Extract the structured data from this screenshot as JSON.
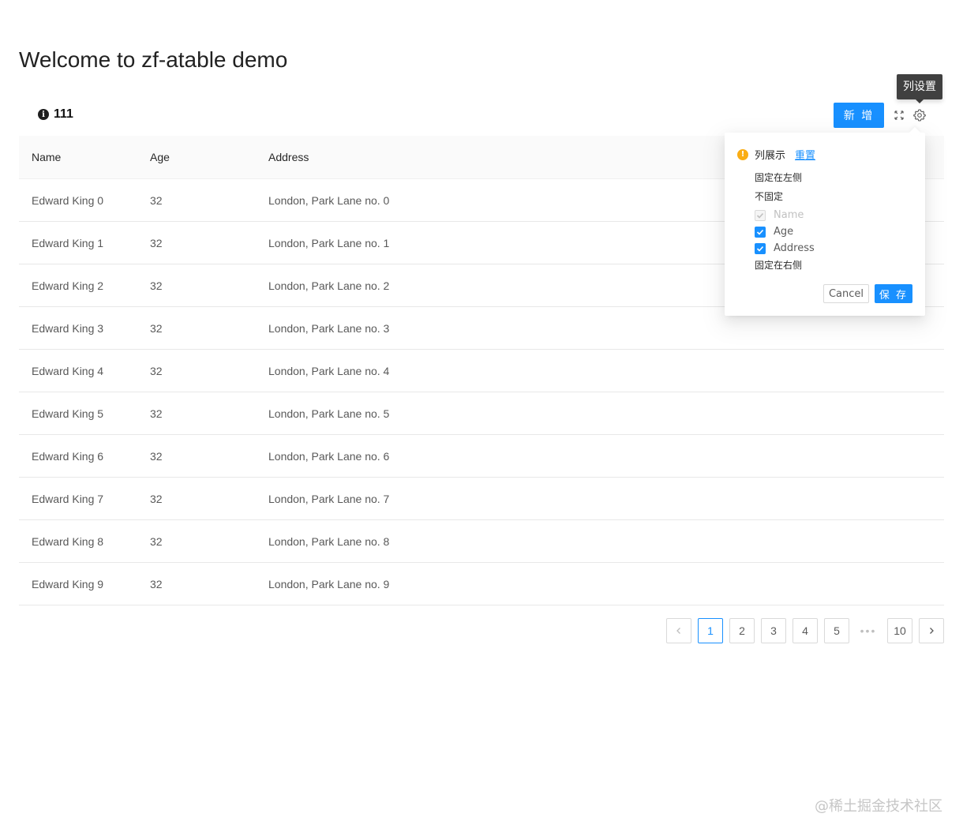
{
  "page": {
    "title": "Welcome to zf-atable demo"
  },
  "toolbar": {
    "info_value": "111",
    "add_button": "新 增",
    "tooltip": "列设置"
  },
  "table": {
    "headers": [
      "Name",
      "Age",
      "Address"
    ],
    "rows": [
      [
        "Edward King 0",
        "32",
        "London, Park Lane no. 0"
      ],
      [
        "Edward King 1",
        "32",
        "London, Park Lane no. 1"
      ],
      [
        "Edward King 2",
        "32",
        "London, Park Lane no. 2"
      ],
      [
        "Edward King 3",
        "32",
        "London, Park Lane no. 3"
      ],
      [
        "Edward King 4",
        "32",
        "London, Park Lane no. 4"
      ],
      [
        "Edward King 5",
        "32",
        "London, Park Lane no. 5"
      ],
      [
        "Edward King 6",
        "32",
        "London, Park Lane no. 6"
      ],
      [
        "Edward King 7",
        "32",
        "London, Park Lane no. 7"
      ],
      [
        "Edward King 8",
        "32",
        "London, Park Lane no. 8"
      ],
      [
        "Edward King 9",
        "32",
        "London, Park Lane no. 9"
      ]
    ]
  },
  "column_settings": {
    "title": "列展示",
    "reset": "重置",
    "fixed_left": "固定在左侧",
    "not_fixed": "不固定",
    "columns": [
      {
        "label": "Name",
        "checked": true,
        "disabled": true
      },
      {
        "label": "Age",
        "checked": true,
        "disabled": false
      },
      {
        "label": "Address",
        "checked": true,
        "disabled": false
      }
    ],
    "fixed_right": "固定在右侧",
    "cancel": "Cancel",
    "save": "保 存"
  },
  "pagination": {
    "pages": [
      "1",
      "2",
      "3",
      "4",
      "5"
    ],
    "ellipsis": "•••",
    "last": "10",
    "current": "1",
    "prev_icon": "chevron-left-icon",
    "next_icon": "chevron-right-icon"
  },
  "watermark": "@稀土掘金技术社区",
  "colors": {
    "primary": "#1890ff",
    "warning": "#faad14"
  }
}
